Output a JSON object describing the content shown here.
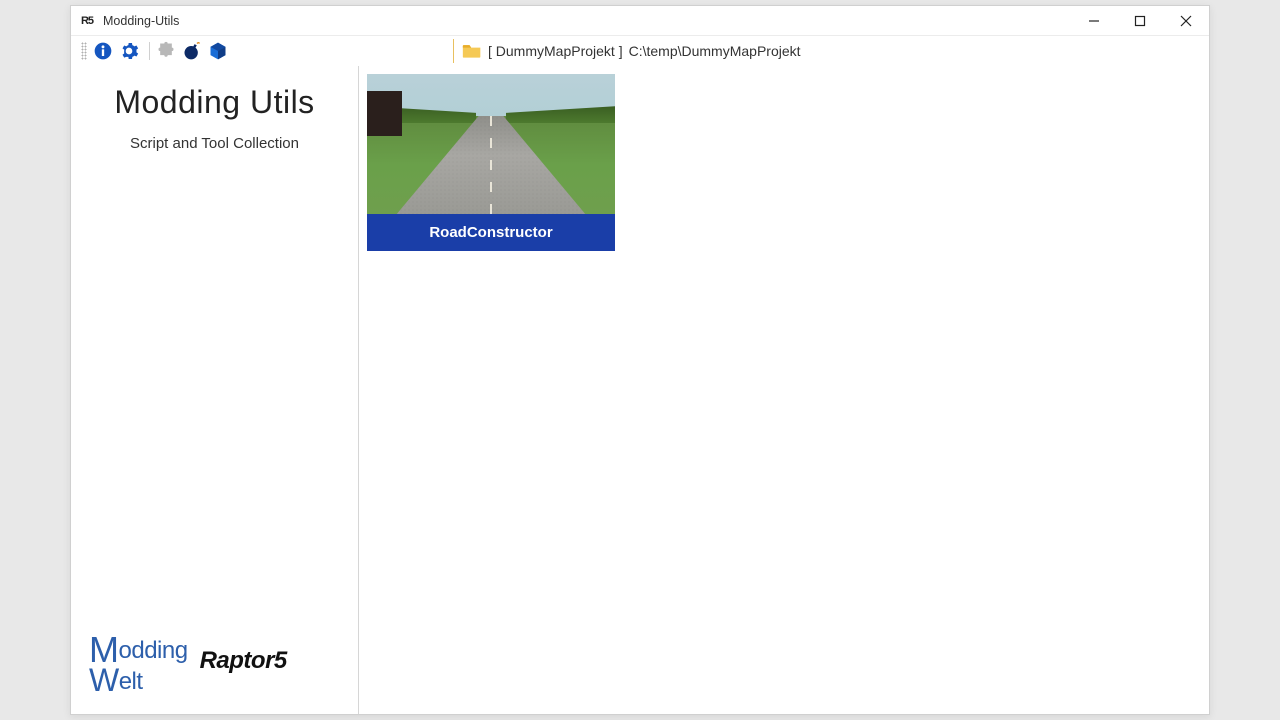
{
  "window": {
    "title": "Modding-Utils",
    "app_icon_text": "R5"
  },
  "path_bar": {
    "project_display": "[ DummyMapProjekt ]",
    "project_path": "C:\\temp\\DummyMapProjekt"
  },
  "sidebar": {
    "heading": "Modding Utils",
    "subtitle": "Script and Tool Collection",
    "logo_modding_top": "odding",
    "logo_modding_bot": "elt",
    "logo_raptor": "Raptor5"
  },
  "cards": [
    {
      "label": "RoadConstructor"
    }
  ],
  "colors": {
    "accent_blue": "#1a3ea8"
  }
}
